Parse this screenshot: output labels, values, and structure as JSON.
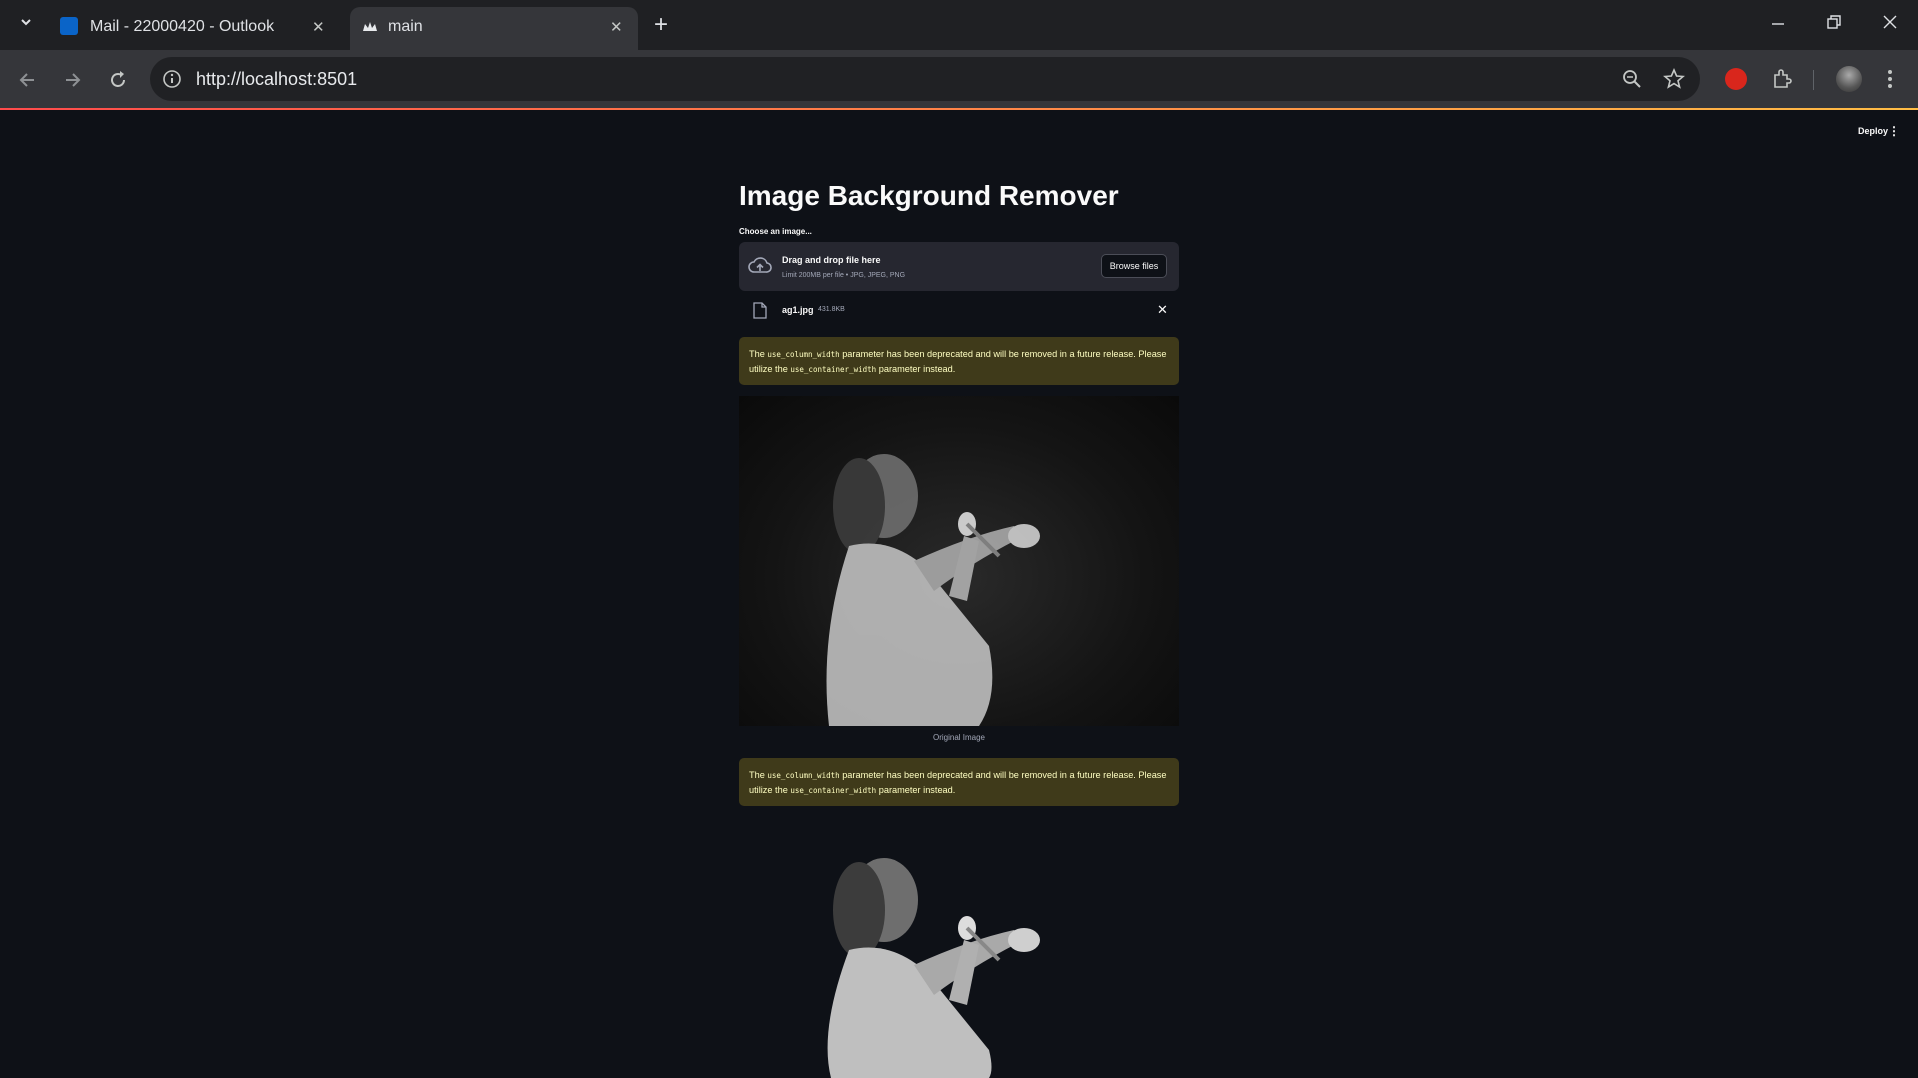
{
  "browser": {
    "tabs": [
      {
        "label": "Mail - 22000420 - Outlook"
      },
      {
        "label": "main"
      }
    ],
    "url": "http://localhost:8501"
  },
  "app": {
    "deploy_label": "Deploy",
    "title": "Image Background Remover",
    "uploader": {
      "label": "Choose an image...",
      "drag_text": "Drag and drop file here",
      "limit_text": "Limit 200MB per file • JPG, JPEG, PNG",
      "browse_label": "Browse files"
    },
    "file": {
      "name": "ag1.jpg",
      "size": "431.8KB"
    },
    "warnings": [
      {
        "part1": "The ",
        "code1": "use_column_width",
        "part2": " parameter has been deprecated and will be removed in a future release. Please utilize the ",
        "code2": "use_container_width",
        "part3": " parameter instead."
      },
      {
        "part1": "The ",
        "code1": "use_column_width",
        "part2": " parameter has been deprecated and will be removed in a future release. Please utilize the ",
        "code2": "use_container_width",
        "part3": " parameter instead."
      }
    ],
    "original_caption": "Original Image"
  },
  "colors": {
    "app_bg": "#0e1117",
    "warning_bg": "#3f3a1a",
    "warning_text": "#ffffc2",
    "accent_gradient": [
      "#ff4b4b",
      "#ffbd45"
    ]
  }
}
